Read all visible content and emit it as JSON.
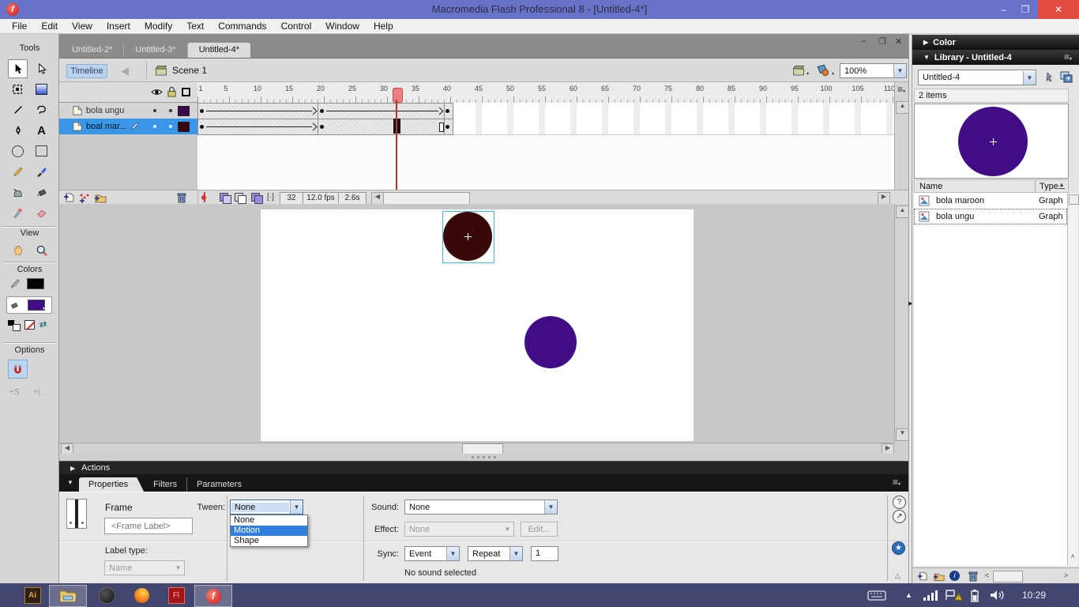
{
  "window": {
    "title": "Macromedia Flash Professional 8 - [Untitled-4*]"
  },
  "menu_bar": {
    "items": [
      "File",
      "Edit",
      "View",
      "Insert",
      "Modify",
      "Text",
      "Commands",
      "Control",
      "Window",
      "Help"
    ]
  },
  "document_tabs": {
    "tabs": [
      {
        "label": "Untitled-2*",
        "active": false
      },
      {
        "label": "Untitled-3*",
        "active": false
      },
      {
        "label": "Untitled-4*",
        "active": true
      }
    ]
  },
  "edit_bar": {
    "timeline_button": "Timeline",
    "scene_name": "Scene 1",
    "zoom_level": "100%"
  },
  "tools_panel": {
    "tools_label": "Tools",
    "view_label": "View",
    "colors_label": "Colors",
    "options_label": "Options",
    "stroke_color": "#000000",
    "fill_color": "#400d86"
  },
  "timeline": {
    "layers": [
      {
        "name": "bola ungu",
        "swatch": "#3a0a4a",
        "selected": false
      },
      {
        "name": "boal mar...",
        "swatch": "#3a070f",
        "selected": true
      }
    ],
    "ruler_labels": [
      1,
      5,
      10,
      15,
      20,
      25,
      30,
      35,
      40,
      45,
      50,
      55,
      60,
      65,
      70,
      75,
      80,
      85,
      90,
      95,
      100,
      105,
      110
    ],
    "playhead_frame": 32,
    "current_frame": "32",
    "frame_rate": "12.0 fps",
    "elapsed_time": "2.6s"
  },
  "stage": {
    "maroon_circle": "#38090b",
    "purple_circle": "#400d86",
    "selection_color": "#4cb3e2"
  },
  "actions_bar": {
    "title": "Actions"
  },
  "properties": {
    "tabs": [
      {
        "label": "Properties",
        "active": true
      },
      {
        "label": "Filters",
        "active": false
      },
      {
        "label": "Parameters",
        "active": false
      }
    ],
    "element_type": "Frame",
    "frame_label_placeholder": "<Frame Label>",
    "label_type_label": "Label type:",
    "label_type_value": "Name",
    "tween_label": "Tween:",
    "tween_value": "None",
    "tween_options": [
      "None",
      "Motion",
      "Shape"
    ],
    "tween_highlighted_index": 1,
    "sound_label": "Sound:",
    "sound_value": "None",
    "effect_label": "Effect:",
    "effect_value": "None",
    "edit_button_label": "Edit...",
    "sync_label": "Sync:",
    "sync_value": "Event",
    "loop_value": "Repeat",
    "repeat_count": "1",
    "status_text": "No sound selected"
  },
  "library": {
    "color_panel_title": "Color",
    "panel_title": "Library - Untitled-4",
    "document_name": "Untitled-4",
    "item_count": "2 items",
    "name_column": "Name",
    "type_column": "Type",
    "items": [
      {
        "name": "bola maroon",
        "type": "Graph"
      },
      {
        "name": "bola ungu",
        "type": "Graph"
      }
    ],
    "preview_color": "#400d86"
  },
  "taskbar": {
    "time": "10:29"
  }
}
